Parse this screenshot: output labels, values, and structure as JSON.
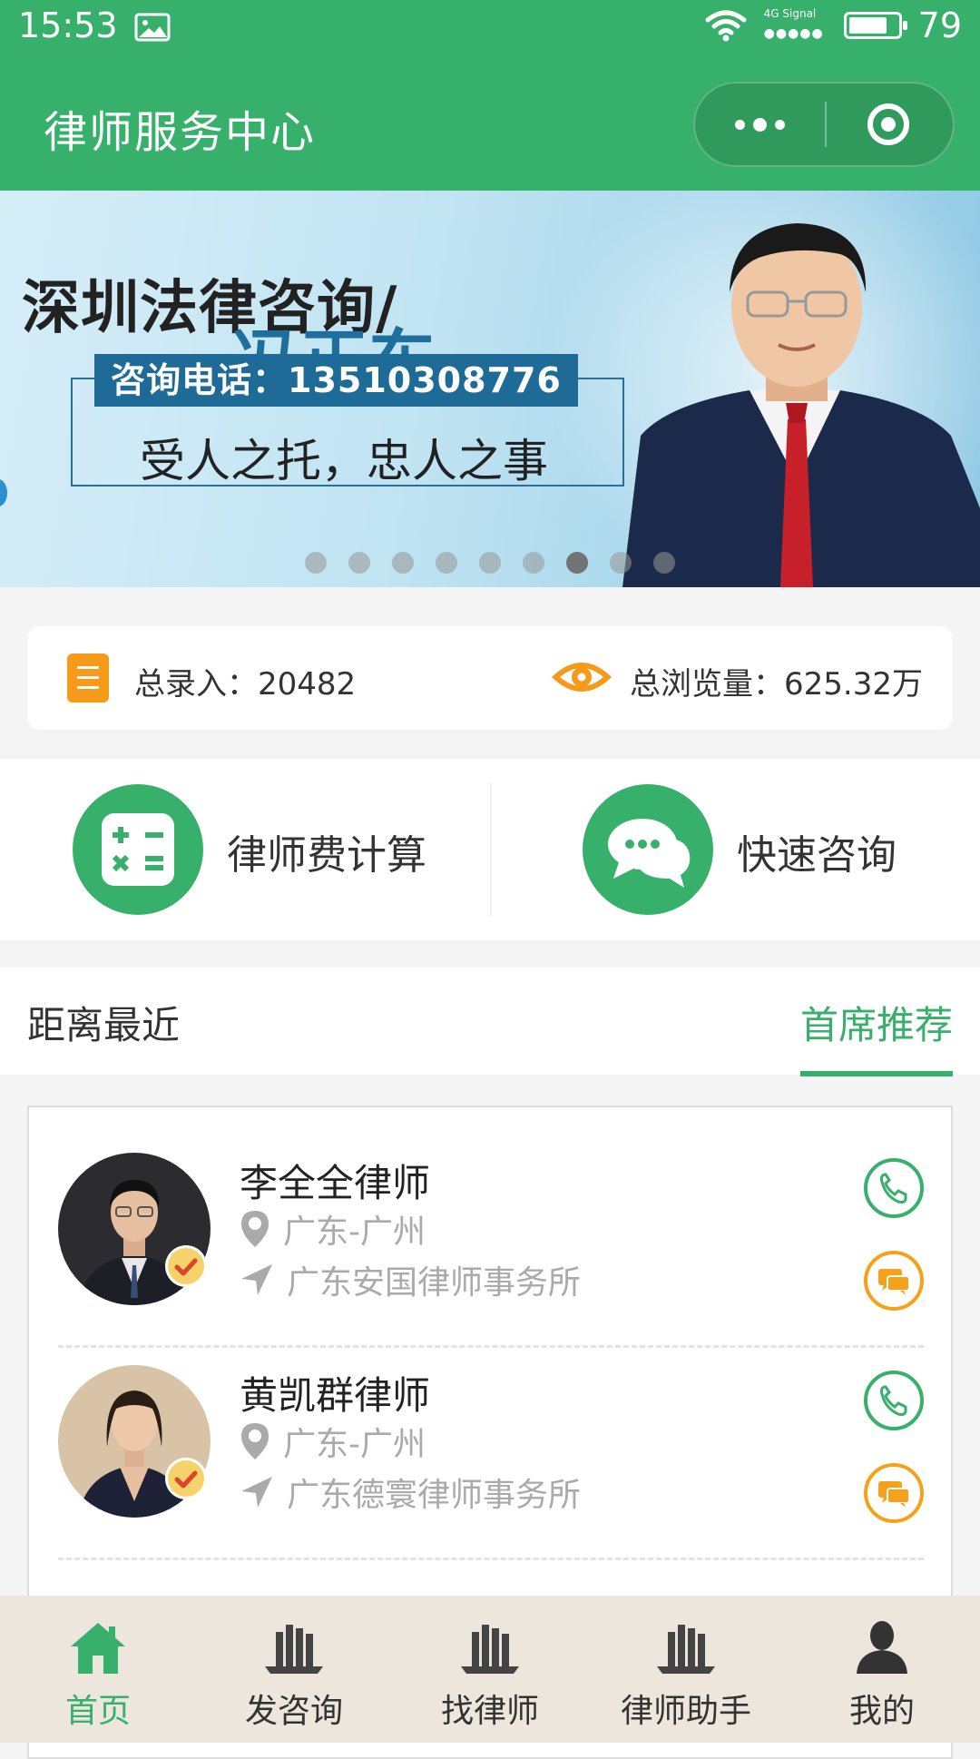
{
  "status_bar": {
    "time": "15:53",
    "network": "4G",
    "signal_label": "Signal",
    "battery": "79",
    "battery_level": 0.79
  },
  "header": {
    "title": "律师服务中心"
  },
  "banner": {
    "headline_prefix": "深圳法律咨询/",
    "headline_name": "冯正东",
    "phone": "咨询电话：13510308776",
    "slogan": "受人之托，忠人之事",
    "dot_count": 9,
    "active_dot": 6
  },
  "stats": {
    "entries": "总录入：20482",
    "views": "总浏览量：625.32万"
  },
  "actions": [
    {
      "label": "律师费计算",
      "icon": "calculator-icon"
    },
    {
      "label": "快速咨询",
      "icon": "chat-bubbles-icon"
    }
  ],
  "tabs": {
    "nearest": "距离最近",
    "recommended": "首席推荐",
    "active": "recommended"
  },
  "lawyers": [
    {
      "name": "李全全律师",
      "location": "广东-广州",
      "firm": "广东安国律师事务所",
      "verified": true
    },
    {
      "name": "黄凯群律师",
      "location": "广东-广州",
      "firm": "广东德寰律师事务所",
      "verified": true
    }
  ],
  "nav": [
    {
      "label": "首页",
      "icon": "home-icon",
      "active": true
    },
    {
      "label": "发咨询",
      "icon": "books-icon",
      "active": false
    },
    {
      "label": "找律师",
      "icon": "books-icon",
      "active": false
    },
    {
      "label": "律师助手",
      "icon": "books-icon",
      "active": false
    },
    {
      "label": "我的",
      "icon": "user-icon",
      "active": false
    }
  ],
  "colors": {
    "primary": "#36b06a",
    "accent_orange": "#f79a1a",
    "nav_bg": "#ece6dd"
  }
}
